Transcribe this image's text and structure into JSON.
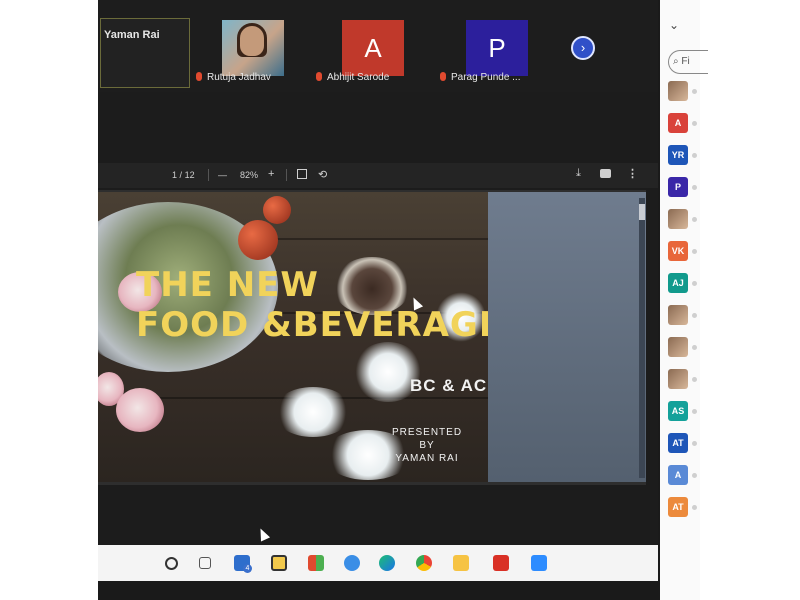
{
  "meeting": {
    "speaker": {
      "name": "Yaman Rai"
    },
    "participants": [
      {
        "name": "Rutuja Jadhav",
        "type": "video"
      },
      {
        "name": "Abhijit Sarode",
        "initial": "A",
        "color": "#c0392b"
      },
      {
        "name": "Parag Punde ...",
        "initial": "P",
        "color": "#2c1f9c"
      }
    ],
    "next_icon": "chevron-right-circle-icon"
  },
  "pdf": {
    "page_current": "1",
    "page_sep": "/",
    "page_total": "12",
    "zoom_out": "—",
    "zoom": "82%",
    "zoom_in": "+"
  },
  "slide": {
    "title_line1": "THE NEW",
    "title_line2": "FOOD &BEVERAGE",
    "subtitle": "BC & AC",
    "presented_by": "PRESENTED BY",
    "presenter": "YAMAN RAI",
    "title_color": "#f1d35a"
  },
  "sidebar": {
    "search_placeholder": "Fi",
    "avatars": [
      {
        "label": "",
        "color": "photo"
      },
      {
        "label": "A",
        "color": "#d9423a"
      },
      {
        "label": "YR",
        "color": "#1e56b8"
      },
      {
        "label": "P",
        "color": "#3a27a8"
      },
      {
        "label": "",
        "color": "photo"
      },
      {
        "label": "VK",
        "color": "#e8663a"
      },
      {
        "label": "AJ",
        "color": "#119a8c"
      },
      {
        "label": "",
        "color": "photo"
      },
      {
        "label": "",
        "color": "photo"
      },
      {
        "label": "",
        "color": "photo"
      },
      {
        "label": "AS",
        "color": "#14a19a"
      },
      {
        "label": "AT",
        "color": "#1e56b8"
      },
      {
        "label": "A",
        "color": "#5a8ad6"
      },
      {
        "label": "AT",
        "color": "#ec8a3c"
      }
    ]
  },
  "taskbar": {
    "mail_badge": "4",
    "apps": [
      "search-icon",
      "task-view-icon",
      "mail-icon",
      "sticky-notes-icon",
      "store-icon",
      "edge-legacy-icon",
      "edge-icon",
      "chrome-icon",
      "file-explorer-icon",
      "acrobat-icon",
      "zoom-icon"
    ]
  }
}
